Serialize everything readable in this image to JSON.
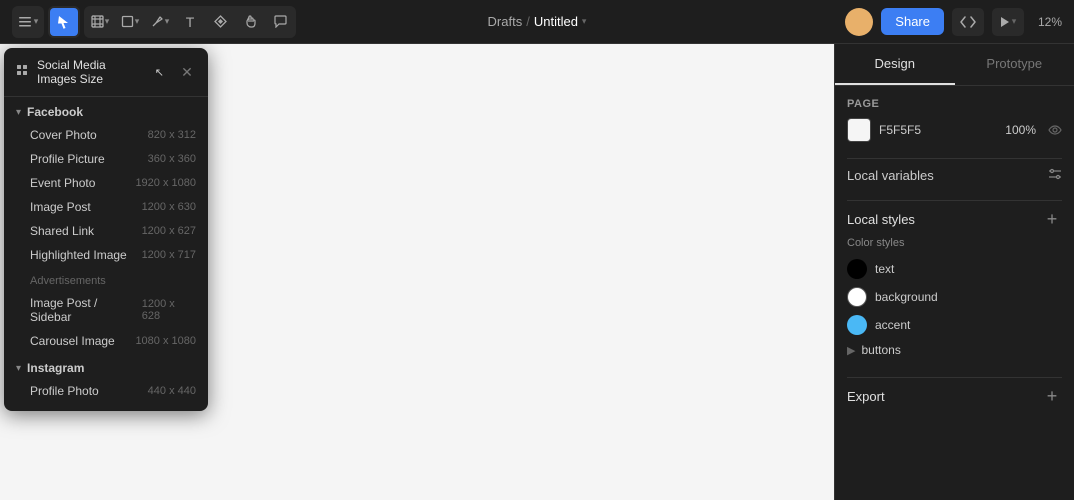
{
  "topbar": {
    "drafts_label": "Drafts",
    "breadcrumb_sep": "/",
    "title": "Untitled",
    "share_label": "Share",
    "zoom_label": "12%",
    "tools": [
      {
        "name": "menu-tool",
        "icon": "☰",
        "active": false
      },
      {
        "name": "select-tool",
        "icon": "▲",
        "active": true
      },
      {
        "name": "frame-tool",
        "icon": "⬜",
        "active": false
      },
      {
        "name": "shape-tool",
        "icon": "◇",
        "active": false
      },
      {
        "name": "pen-tool",
        "icon": "✒",
        "active": false
      },
      {
        "name": "text-tool",
        "icon": "T",
        "active": false
      },
      {
        "name": "component-tool",
        "icon": "❖",
        "active": false
      },
      {
        "name": "hand-tool",
        "icon": "✋",
        "active": false
      },
      {
        "name": "comment-tool",
        "icon": "💬",
        "active": false
      }
    ]
  },
  "dropdown": {
    "title": "Social Media Images Size",
    "sections": [
      {
        "label": "Facebook",
        "items": [
          {
            "name": "Cover Photo",
            "size": "820 x 312"
          },
          {
            "name": "Profile Picture",
            "size": "360 x 360"
          },
          {
            "name": "Event Photo",
            "size": "1920 x 1080"
          },
          {
            "name": "Image Post",
            "size": "1200 x 630"
          },
          {
            "name": "Shared Link",
            "size": "1200 x 627"
          },
          {
            "name": "Highlighted Image",
            "size": "1200 x 717"
          }
        ],
        "subsections": [
          {
            "label": "Advertisements",
            "items": [
              {
                "name": "Image Post / Sidebar",
                "size": "1200 x 628"
              },
              {
                "name": "Carousel Image",
                "size": "1080 x 1080"
              }
            ]
          }
        ]
      },
      {
        "label": "Instagram",
        "items": [
          {
            "name": "Profile Photo",
            "size": "440 x 440"
          }
        ]
      }
    ]
  },
  "right_panel": {
    "tabs": [
      {
        "label": "Design",
        "active": true
      },
      {
        "label": "Prototype",
        "active": false
      }
    ],
    "page_section": {
      "label": "Page",
      "color_value": "F5F5F5",
      "opacity_value": "100%"
    },
    "local_variables": {
      "label": "Local variables"
    },
    "local_styles": {
      "label": "Local styles",
      "color_styles_label": "Color styles",
      "styles": [
        {
          "name": "text",
          "color": "#000000",
          "type": "circle"
        },
        {
          "name": "background",
          "color": "#ffffff",
          "type": "circle"
        },
        {
          "name": "accent",
          "color": "#4ab8f5",
          "type": "circle"
        }
      ],
      "buttons_label": "buttons"
    },
    "export": {
      "label": "Export"
    }
  }
}
